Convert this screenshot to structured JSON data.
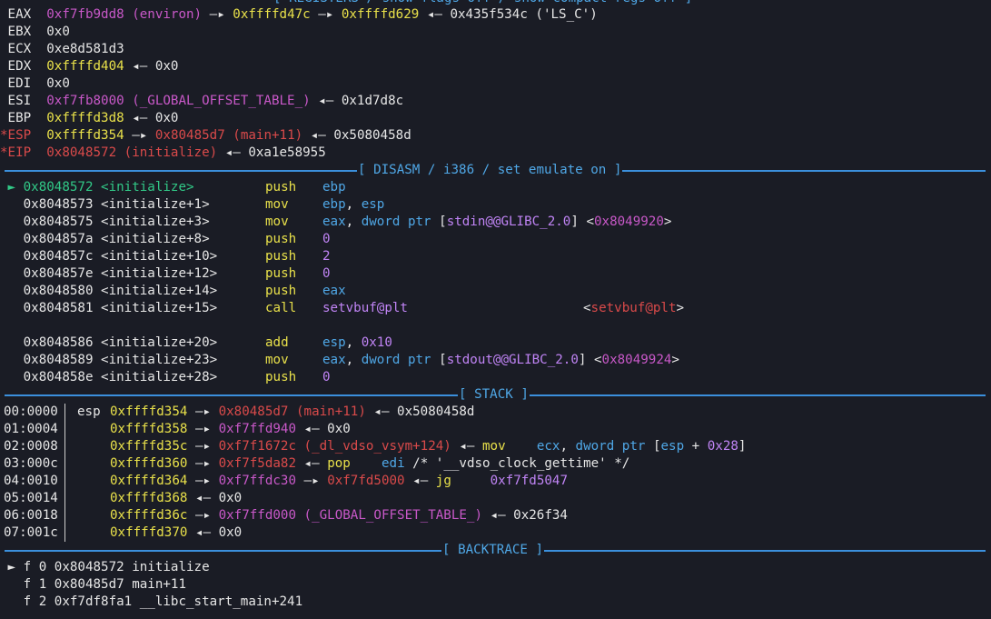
{
  "top_header": "[ REGISTERS / show-flags off / show-compact-regs off ]",
  "registers": [
    {
      "name": "EAX",
      "flag": "",
      "chain": [
        {
          "t": "0xf7fb9dd8 (environ)",
          "c": "mag"
        },
        {
          "t": " —▸ ",
          "c": "white"
        },
        {
          "t": "0xffffd47c",
          "c": "yel"
        },
        {
          "t": " —▸ ",
          "c": "white"
        },
        {
          "t": "0xffffd629",
          "c": "yel"
        },
        {
          "t": " ◂— 0x435f534c ('LS_C')",
          "c": "white"
        }
      ]
    },
    {
      "name": "EBX",
      "flag": "",
      "chain": [
        {
          "t": "0x0",
          "c": "white"
        }
      ]
    },
    {
      "name": "ECX",
      "flag": "",
      "chain": [
        {
          "t": "0xe8d581d3",
          "c": "white"
        }
      ]
    },
    {
      "name": "EDX",
      "flag": "",
      "chain": [
        {
          "t": "0xffffd404",
          "c": "yel"
        },
        {
          "t": " ◂— 0x0",
          "c": "white"
        }
      ]
    },
    {
      "name": "EDI",
      "flag": "",
      "chain": [
        {
          "t": "0x0",
          "c": "white"
        }
      ]
    },
    {
      "name": "ESI",
      "flag": "",
      "chain": [
        {
          "t": "0xf7fb8000 (_GLOBAL_OFFSET_TABLE_)",
          "c": "mag"
        },
        {
          "t": " ◂— 0x1d7d8c",
          "c": "white"
        }
      ]
    },
    {
      "name": "EBP",
      "flag": "",
      "chain": [
        {
          "t": "0xffffd3d8",
          "c": "yel"
        },
        {
          "t": " ◂— 0x0",
          "c": "white"
        }
      ]
    },
    {
      "name": "ESP",
      "flag": "*",
      "chain": [
        {
          "t": "0xffffd354",
          "c": "yel"
        },
        {
          "t": " —▸ ",
          "c": "white"
        },
        {
          "t": "0x80485d7 (main+11)",
          "c": "red"
        },
        {
          "t": " ◂— 0x5080458d",
          "c": "white"
        }
      ]
    },
    {
      "name": "EIP",
      "flag": "*",
      "chain": [
        {
          "t": "0x8048572 (initialize)",
          "c": "red"
        },
        {
          "t": " ◂— 0xa1e58955",
          "c": "white"
        }
      ]
    }
  ],
  "disasm_header": "[ DISASM / i386 / set emulate on ]",
  "disasm": [
    {
      "arrow": "►",
      "addr": "0x8048572 <initialize>",
      "current": true,
      "mn": "push",
      "ops": [
        {
          "t": "ebp",
          "c": "blue"
        }
      ],
      "ann": []
    },
    {
      "arrow": "",
      "addr": "0x8048573 <initialize+1>",
      "mn": "mov",
      "ops": [
        {
          "t": "ebp",
          "c": "blue"
        },
        {
          "t": ", ",
          "c": "white"
        },
        {
          "t": "esp",
          "c": "blue"
        }
      ],
      "ann": []
    },
    {
      "arrow": "",
      "addr": "0x8048575 <initialize+3>",
      "mn": "mov",
      "ops": [
        {
          "t": "eax",
          "c": "blue"
        },
        {
          "t": ", ",
          "c": "white"
        },
        {
          "t": "dword ptr",
          "c": "blue"
        },
        {
          "t": " [",
          "c": "white"
        },
        {
          "t": "stdin@@GLIBC_2.0",
          "c": "pur"
        },
        {
          "t": "] <",
          "c": "white"
        },
        {
          "t": "0x8049920",
          "c": "mag"
        },
        {
          "t": ">",
          "c": "white"
        }
      ],
      "ann": []
    },
    {
      "arrow": "",
      "addr": "0x804857a <initialize+8>",
      "mn": "push",
      "ops": [
        {
          "t": "0",
          "c": "pur"
        }
      ],
      "ann": []
    },
    {
      "arrow": "",
      "addr": "0x804857c <initialize+10>",
      "mn": "push",
      "ops": [
        {
          "t": "2",
          "c": "pur"
        }
      ],
      "ann": []
    },
    {
      "arrow": "",
      "addr": "0x804857e <initialize+12>",
      "mn": "push",
      "ops": [
        {
          "t": "0",
          "c": "pur"
        }
      ],
      "ann": []
    },
    {
      "arrow": "",
      "addr": "0x8048580 <initialize+14>",
      "mn": "push",
      "ops": [
        {
          "t": "eax",
          "c": "blue"
        }
      ],
      "ann": []
    },
    {
      "arrow": "",
      "addr": "0x8048581 <initialize+15>",
      "mn": "call",
      "ops": [
        {
          "t": "setvbuf@plt",
          "c": "pur"
        }
      ],
      "ann": [
        {
          "t": "<",
          "c": "white"
        },
        {
          "t": "setvbuf@plt",
          "c": "red"
        },
        {
          "t": ">",
          "c": "white"
        }
      ]
    },
    {
      "blank": true
    },
    {
      "arrow": "",
      "addr": "0x8048586 <initialize+20>",
      "mn": "add",
      "ops": [
        {
          "t": "esp",
          "c": "blue"
        },
        {
          "t": ", ",
          "c": "white"
        },
        {
          "t": "0x10",
          "c": "pur"
        }
      ],
      "ann": []
    },
    {
      "arrow": "",
      "addr": "0x8048589 <initialize+23>",
      "mn": "mov",
      "ops": [
        {
          "t": "eax",
          "c": "blue"
        },
        {
          "t": ", ",
          "c": "white"
        },
        {
          "t": "dword ptr",
          "c": "blue"
        },
        {
          "t": " [",
          "c": "white"
        },
        {
          "t": "stdout@@GLIBC_2.0",
          "c": "pur"
        },
        {
          "t": "] <",
          "c": "white"
        },
        {
          "t": "0x8049924",
          "c": "mag"
        },
        {
          "t": ">",
          "c": "white"
        }
      ],
      "ann": []
    },
    {
      "arrow": "",
      "addr": "0x804858e <initialize+28>",
      "mn": "push",
      "ops": [
        {
          "t": "0",
          "c": "pur"
        }
      ],
      "ann": []
    }
  ],
  "stack_header": "[ STACK ]",
  "stack": [
    {
      "idx": "00:0000",
      "reg": "esp",
      "chain": [
        {
          "t": "0xffffd354",
          "c": "yel"
        },
        {
          "t": " —▸ ",
          "c": "white"
        },
        {
          "t": "0x80485d7 (main+11)",
          "c": "red"
        },
        {
          "t": " ◂— 0x5080458d",
          "c": "white"
        }
      ]
    },
    {
      "idx": "01:0004",
      "reg": "",
      "chain": [
        {
          "t": "0xffffd358",
          "c": "yel"
        },
        {
          "t": " —▸ ",
          "c": "white"
        },
        {
          "t": "0xf7ffd940",
          "c": "mag"
        },
        {
          "t": " ◂— 0x0",
          "c": "white"
        }
      ]
    },
    {
      "idx": "02:0008",
      "reg": "",
      "chain": [
        {
          "t": "0xffffd35c",
          "c": "yel"
        },
        {
          "t": " —▸ ",
          "c": "white"
        },
        {
          "t": "0xf7f1672c (_dl_vdso_vsym+124)",
          "c": "red"
        },
        {
          "t": " ◂— ",
          "c": "white"
        },
        {
          "t": "mov",
          "c": "olive"
        },
        {
          "t": "    ",
          "c": "white"
        },
        {
          "t": "ecx",
          "c": "blue"
        },
        {
          "t": ", ",
          "c": "white"
        },
        {
          "t": "dword ptr",
          "c": "blue"
        },
        {
          "t": " [",
          "c": "white"
        },
        {
          "t": "esp",
          "c": "blue"
        },
        {
          "t": " + ",
          "c": "white"
        },
        {
          "t": "0x28",
          "c": "pur"
        },
        {
          "t": "]",
          "c": "white"
        }
      ]
    },
    {
      "idx": "03:000c",
      "reg": "",
      "chain": [
        {
          "t": "0xffffd360",
          "c": "yel"
        },
        {
          "t": " —▸ ",
          "c": "white"
        },
        {
          "t": "0xf7f5da82",
          "c": "red"
        },
        {
          "t": " ◂— ",
          "c": "white"
        },
        {
          "t": "pop",
          "c": "olive"
        },
        {
          "t": "    ",
          "c": "white"
        },
        {
          "t": "edi",
          "c": "blue"
        },
        {
          "t": " /* '__vdso_clock_gettime' */",
          "c": "white"
        }
      ]
    },
    {
      "idx": "04:0010",
      "reg": "",
      "chain": [
        {
          "t": "0xffffd364",
          "c": "yel"
        },
        {
          "t": " —▸ ",
          "c": "white"
        },
        {
          "t": "0xf7ffdc30",
          "c": "mag"
        },
        {
          "t": " —▸ ",
          "c": "white"
        },
        {
          "t": "0xf7fd5000",
          "c": "red"
        },
        {
          "t": " ◂— ",
          "c": "white"
        },
        {
          "t": "jg",
          "c": "olive"
        },
        {
          "t": "     ",
          "c": "white"
        },
        {
          "t": "0xf7fd5047",
          "c": "pur"
        }
      ]
    },
    {
      "idx": "05:0014",
      "reg": "",
      "chain": [
        {
          "t": "0xffffd368",
          "c": "yel"
        },
        {
          "t": " ◂— 0x0",
          "c": "white"
        }
      ]
    },
    {
      "idx": "06:0018",
      "reg": "",
      "chain": [
        {
          "t": "0xffffd36c",
          "c": "yel"
        },
        {
          "t": " —▸ ",
          "c": "white"
        },
        {
          "t": "0xf7ffd000 (_GLOBAL_OFFSET_TABLE_)",
          "c": "mag"
        },
        {
          "t": " ◂— 0x26f34",
          "c": "white"
        }
      ]
    },
    {
      "idx": "07:001c",
      "reg": "",
      "chain": [
        {
          "t": "0xffffd370",
          "c": "yel"
        },
        {
          "t": " ◂— 0x0",
          "c": "white"
        }
      ]
    }
  ],
  "backtrace_header": "[ BACKTRACE ]",
  "backtrace": [
    {
      "arrow": "►",
      "text": "f 0 0x8048572 initialize"
    },
    {
      "arrow": "",
      "text": "f 1 0x80485d7 main+11"
    },
    {
      "arrow": "",
      "text": "f 2 0xf7df8fa1 __libc_start_main+241"
    }
  ]
}
